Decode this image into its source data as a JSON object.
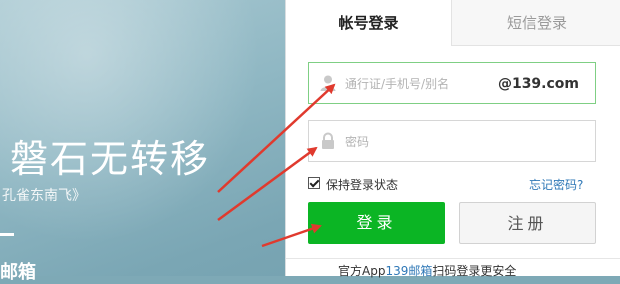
{
  "background": {
    "poem_title": "磐石无转移",
    "poem_source": "孔雀东南飞》",
    "bottom_text": "邮箱"
  },
  "login": {
    "tabs": [
      {
        "label": "帐号登录",
        "active": true
      },
      {
        "label": "短信登录",
        "active": false
      }
    ],
    "username": {
      "placeholder": "通行证/手机号/别名",
      "value": "",
      "suffix": "@139.com"
    },
    "password": {
      "placeholder": "密码",
      "value": ""
    },
    "remember": {
      "label": "保持登录状态",
      "checked": true
    },
    "forgot_label": "忘记密码?",
    "login_button": "登录",
    "register_button": "注册",
    "footer": {
      "prefix": "官方App",
      "highlight": "139邮箱",
      "suffix": "扫码登录更安全"
    }
  },
  "annotations": {
    "arrow_color": "#e03a2e",
    "count": 3
  },
  "colors": {
    "accent_green": "#0bb524",
    "link_blue": "#2f78b7",
    "focus_border": "#7fcf84"
  }
}
